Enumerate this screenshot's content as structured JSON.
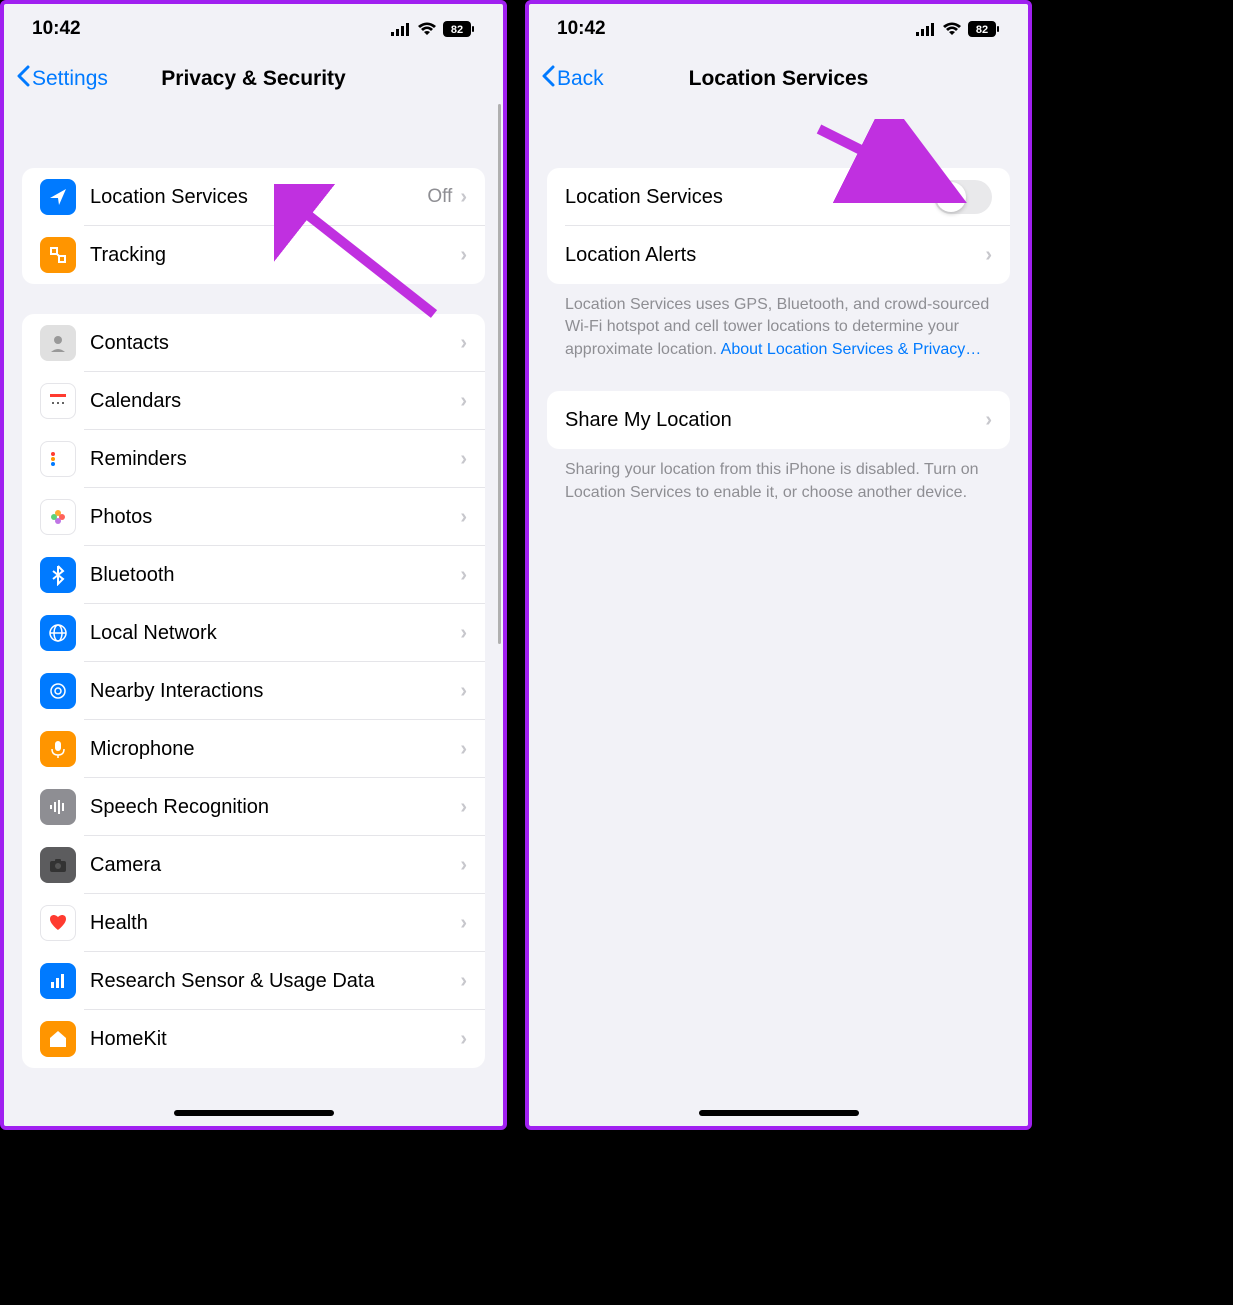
{
  "status": {
    "time": "10:42",
    "battery": "82"
  },
  "left": {
    "back_label": "Settings",
    "title": "Privacy & Security",
    "section1": [
      {
        "label": "Location Services",
        "value": "Off",
        "icon_bg": "#007aff"
      },
      {
        "label": "Tracking",
        "icon_bg": "#ff9500"
      }
    ],
    "section2": [
      {
        "label": "Contacts",
        "icon_bg": "#e5e5e5"
      },
      {
        "label": "Calendars",
        "icon_bg": "#ffffff"
      },
      {
        "label": "Reminders",
        "icon_bg": "#ffffff"
      },
      {
        "label": "Photos",
        "icon_bg": "#ffffff"
      },
      {
        "label": "Bluetooth",
        "icon_bg": "#007aff"
      },
      {
        "label": "Local Network",
        "icon_bg": "#007aff"
      },
      {
        "label": "Nearby Interactions",
        "icon_bg": "#007aff"
      },
      {
        "label": "Microphone",
        "icon_bg": "#ff9500"
      },
      {
        "label": "Speech Recognition",
        "icon_bg": "#8e8e93"
      },
      {
        "label": "Camera",
        "icon_bg": "#8e8e93"
      },
      {
        "label": "Health",
        "icon_bg": "#ffffff"
      },
      {
        "label": "Research Sensor & Usage Data",
        "icon_bg": "#007aff"
      },
      {
        "label": "HomeKit",
        "icon_bg": "#ff9500"
      }
    ]
  },
  "right": {
    "back_label": "Back",
    "title": "Location Services",
    "section1": [
      {
        "label": "Location Services",
        "toggle": false
      },
      {
        "label": "Location Alerts"
      }
    ],
    "footer1": "Location Services uses GPS, Bluetooth, and crowd-sourced Wi-Fi hotspot and cell tower locations to determine your approximate location. ",
    "footer1_link": "About Location Services & Privacy…",
    "section2": [
      {
        "label": "Share My Location"
      }
    ],
    "footer2": "Sharing your location from this iPhone is disabled. Turn on Location Services to enable it, or choose another device."
  }
}
